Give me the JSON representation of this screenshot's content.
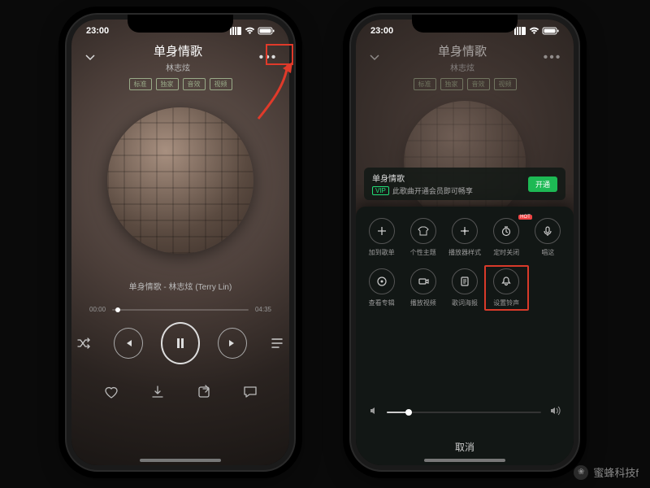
{
  "status": {
    "time": "23:00"
  },
  "song": {
    "title": "单身情歌",
    "artist": "林志炫",
    "now_playing_line": "单身情歌 - 林志炫 (Terry Lin)",
    "time_current": "00:00",
    "time_total": "04:35"
  },
  "tags": [
    "标准",
    "独家",
    "音效",
    "视频"
  ],
  "player_actions": {
    "like": "喜欢",
    "download": "下载",
    "share": "分享",
    "comment": "评论"
  },
  "vip": {
    "title": "单身情歌",
    "badge": "VIP",
    "msg": "此歌曲开通会员即可畅享",
    "btn": "开通"
  },
  "sheet_items_row1": [
    {
      "label": "加到歌单",
      "icon": "plus"
    },
    {
      "label": "个性主题",
      "icon": "shirt"
    },
    {
      "label": "播放器样式",
      "icon": "sliders"
    },
    {
      "label": "定时关闭",
      "icon": "timer",
      "hot": "HOT"
    },
    {
      "label": "唱这",
      "icon": "mic"
    }
  ],
  "sheet_items_row2": [
    {
      "label": "查看专辑",
      "icon": "disc"
    },
    {
      "label": "播放视频",
      "icon": "video"
    },
    {
      "label": "歌词海报",
      "icon": "poster"
    },
    {
      "label": "设置铃声",
      "icon": "bell",
      "highlight": true
    },
    {
      "label": "",
      "icon": ""
    }
  ],
  "cancel": "取消",
  "watermark": "蜜蜂科技f"
}
